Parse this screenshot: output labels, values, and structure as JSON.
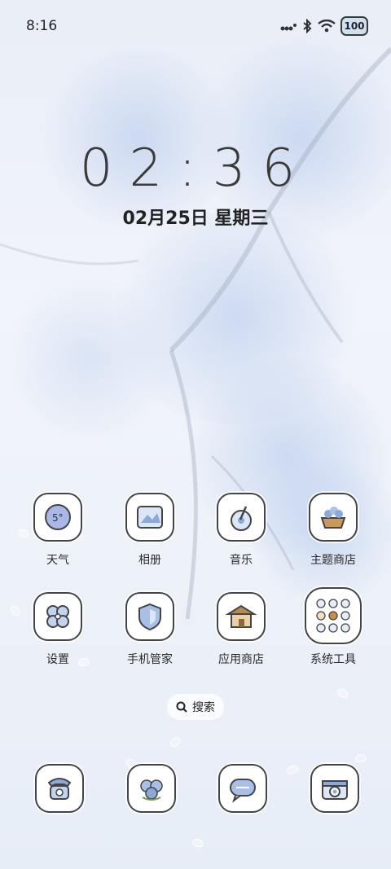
{
  "status_bar": {
    "time": "8:16",
    "battery_level": "100",
    "icons": [
      "signal-icon",
      "bluetooth-icon",
      "wifi-icon",
      "battery-icon"
    ]
  },
  "lockclock": {
    "time": "02:36",
    "date": "02月25日 星期三"
  },
  "apps": [
    {
      "label": "天气",
      "icon": "weather-icon"
    },
    {
      "label": "相册",
      "icon": "gallery-icon"
    },
    {
      "label": "音乐",
      "icon": "music-icon"
    },
    {
      "label": "主题商店",
      "icon": "theme-store-icon"
    },
    {
      "label": "设置",
      "icon": "settings-icon"
    },
    {
      "label": "手机管家",
      "icon": "phone-manager-icon"
    },
    {
      "label": "应用商店",
      "icon": "app-store-icon"
    },
    {
      "label": "系统工具",
      "icon": "system-tools-folder-icon"
    }
  ],
  "search": {
    "label": "搜索"
  },
  "dock": [
    {
      "icon": "phone-icon"
    },
    {
      "icon": "contacts-icon"
    },
    {
      "icon": "messages-icon"
    },
    {
      "icon": "camera-icon"
    }
  ],
  "colors": {
    "accent_blue": "#8ea9d8",
    "outline": "#444444",
    "wallpaper": "#e9eef7"
  }
}
